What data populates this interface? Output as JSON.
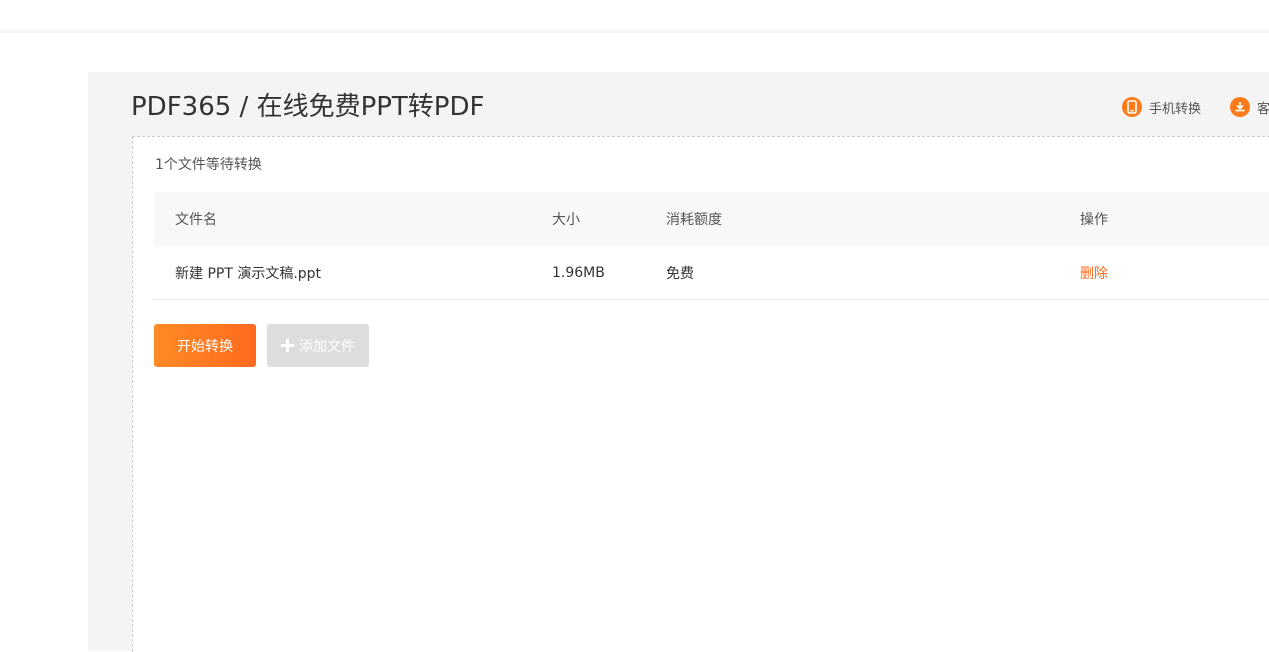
{
  "header": {
    "title": "PDF365 / 在线免费PPT转PDF",
    "links": [
      {
        "label": "手机转换",
        "icon": "phone-icon"
      },
      {
        "label": "客",
        "icon": "download-icon"
      }
    ]
  },
  "upload": {
    "status_text": "1个文件等待转换",
    "columns": [
      "文件名",
      "大小",
      "消耗额度",
      "操作"
    ],
    "files": [
      {
        "name": "新建 PPT 演示文稿.ppt",
        "size": "1.96MB",
        "cost": "免费",
        "action": "删除"
      }
    ]
  },
  "actions": {
    "start_label": "开始转换",
    "add_label": "添加文件"
  },
  "colors": {
    "accent": "#ff7a1a",
    "delete": "#ff6a1f",
    "panel_bg": "#f4f4f4",
    "disabled_button": "#dddddd"
  }
}
